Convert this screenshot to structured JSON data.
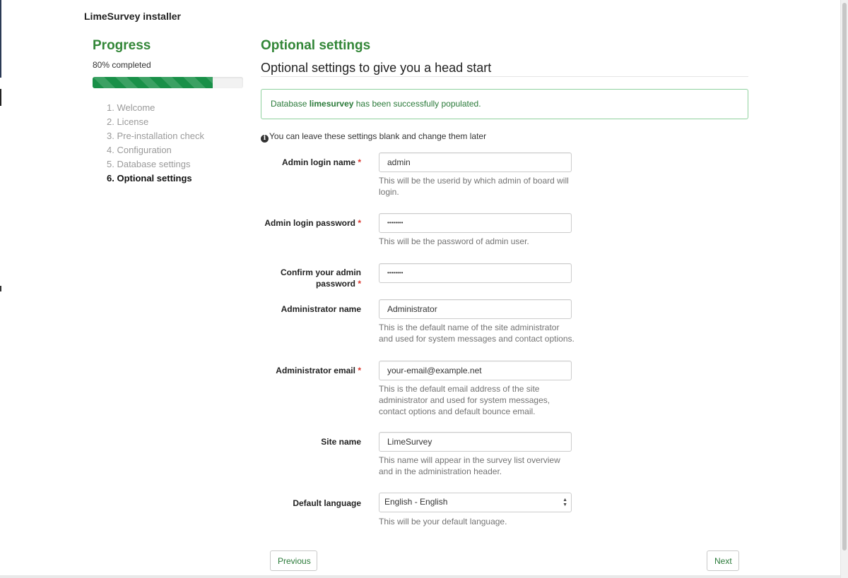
{
  "app": {
    "title": "LimeSurvey installer"
  },
  "progress": {
    "heading": "Progress",
    "text": "80% completed",
    "percent": 80,
    "steps": [
      "1. Welcome",
      "2. License",
      "3. Pre-installation check",
      "4. Configuration",
      "5. Database settings",
      "6. Optional settings"
    ],
    "active_step_index": 5
  },
  "main": {
    "title": "Optional settings",
    "subtitle": "Optional settings to give you a head start",
    "alert": {
      "prefix": "Database ",
      "db_name": "limesurvey",
      "suffix": " has been successfully populated.",
      "color": "#2a7a39"
    },
    "info": "You can leave these settings blank and change them later",
    "fields": {
      "admin_login": {
        "label": "Admin login name",
        "required": "*",
        "value": "admin",
        "help": "This will be the userid by which admin of board will login."
      },
      "admin_password": {
        "label": "Admin login password",
        "required": "*",
        "value": "••••••••",
        "help": "This will be the password of admin user."
      },
      "confirm_password": {
        "label_line1": "Confirm your admin",
        "label_line2": "password",
        "required": "*",
        "value": "••••••••"
      },
      "admin_name": {
        "label": "Administrator name",
        "value": "Administrator",
        "help": "This is the default name of the site administrator and used for system messages and contact options."
      },
      "admin_email": {
        "label": "Administrator email",
        "required": "*",
        "value": "your-email@example.net",
        "help": "This is the default email address of the site administrator and used for system messages, contact options and default bounce email."
      },
      "site_name": {
        "label": "Site name",
        "value": "LimeSurvey",
        "help": "This name will appear in the survey list overview and in the administration header."
      },
      "default_language": {
        "label": "Default language",
        "value": "English - English",
        "help": "This will be your default language."
      }
    },
    "buttons": {
      "previous": "Previous",
      "next": "Next"
    }
  },
  "colors": {
    "accent_green": "#328637",
    "progress_green": "#199048",
    "required_red": "#d9342b"
  }
}
